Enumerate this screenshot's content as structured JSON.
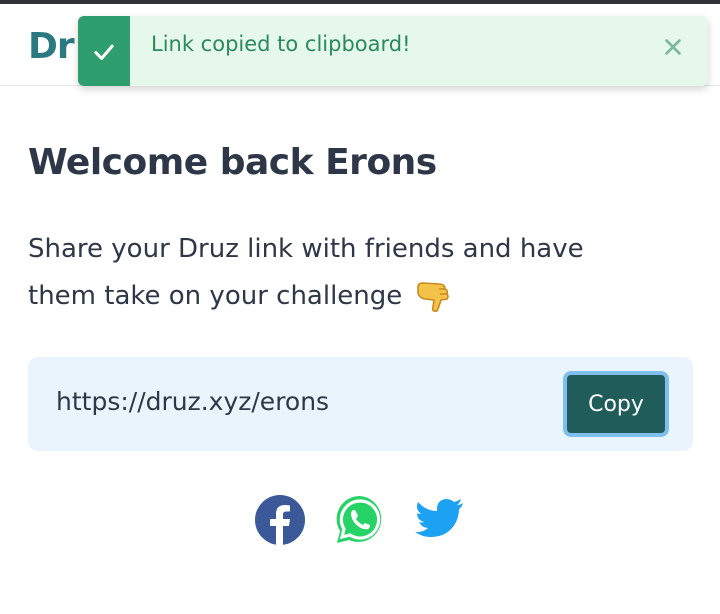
{
  "header": {
    "logo_text": "Dr"
  },
  "toast": {
    "message": "Link copied to clipboard!",
    "icon": "checkmark-icon",
    "close_icon": "close-icon",
    "accent_color": "#2f9e6e",
    "background_color": "#e6f8ec"
  },
  "main": {
    "title": "Welcome back Erons",
    "description_line1": "Share your Druz link with friends and have",
    "description_line2": "them take on your challenge",
    "emoji_icon": "pointing-down-hand-icon"
  },
  "link_box": {
    "url": "https://druz.xyz/erons",
    "copy_label": "Copy",
    "button_color": "#1f5c5a"
  },
  "share": {
    "items": [
      {
        "icon": "facebook-icon",
        "color": "#3b5998"
      },
      {
        "icon": "whatsapp-icon",
        "color": "#25d366"
      },
      {
        "icon": "twitter-icon",
        "color": "#1da1f2"
      }
    ]
  }
}
